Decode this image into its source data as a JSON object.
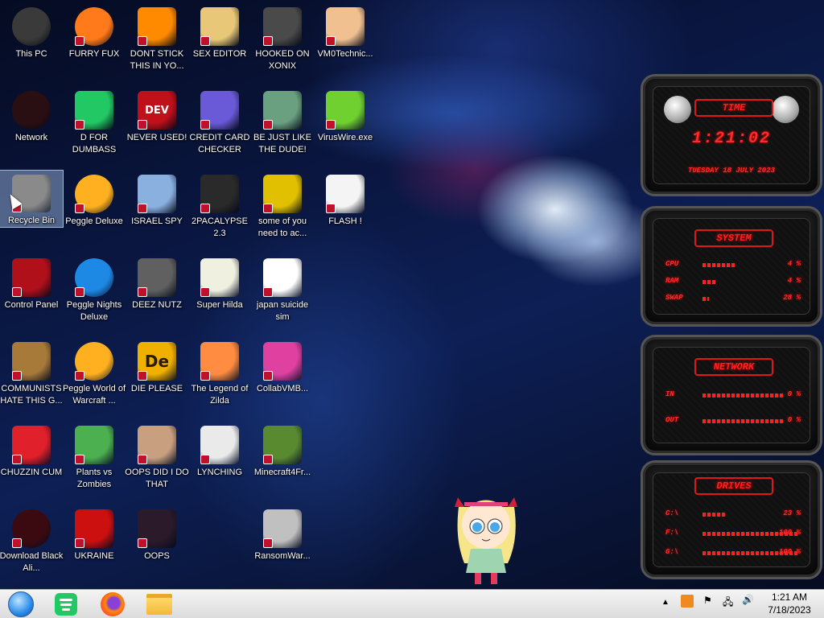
{
  "desktop": {
    "col1": [
      {
        "label": "This PC"
      },
      {
        "label": "Network"
      },
      {
        "label": "Recycle Bin"
      },
      {
        "label": "Control Panel"
      },
      {
        "label": "COMMUNISTS HATE THIS G..."
      },
      {
        "label": "CHUZZIN CUM"
      },
      {
        "label": "Download Black Ali..."
      }
    ],
    "col2": [
      {
        "label": "FURRY FUX"
      },
      {
        "label": "D FOR DUMBASS"
      },
      {
        "label": "Peggle Deluxe"
      },
      {
        "label": "Peggle Nights Deluxe"
      },
      {
        "label": "Peggle World of Warcraft ..."
      },
      {
        "label": "Plants vs Zombies"
      },
      {
        "label": "UKRAINE"
      }
    ],
    "col3": [
      {
        "label": "DONT STICK THIS IN YO..."
      },
      {
        "label": "NEVER USED!"
      },
      {
        "label": "ISRAEL SPY"
      },
      {
        "label": "DEEZ NUTZ"
      },
      {
        "label": "DIE PLEASE"
      },
      {
        "label": "OOPS DID I DO THAT"
      },
      {
        "label": "OOPS"
      }
    ],
    "col4": [
      {
        "label": "SEX EDITOR"
      },
      {
        "label": "CREDIT CARD CHECKER"
      },
      {
        "label": "2PACALYPSE 2.3"
      },
      {
        "label": "Super Hilda"
      },
      {
        "label": "The Legend of Zilda"
      },
      {
        "label": "LYNCHING"
      }
    ],
    "col5": [
      {
        "label": "HOOKED ON XONIX"
      },
      {
        "label": "BE JUST LIKE THE DUDE!"
      },
      {
        "label": "some of you need to ac..."
      },
      {
        "label": "japan suicide sim"
      },
      {
        "label": "CollabVMB..."
      },
      {
        "label": "Minecraft4Fr..."
      },
      {
        "label": "RansomWar..."
      }
    ],
    "col6": [
      {
        "label": "VM0Technic..."
      },
      {
        "label": "VirusWire.exe"
      },
      {
        "label": "FLASH !"
      }
    ],
    "dev_badge": "DEV",
    "dev_plus": "++",
    "de_badge": "De"
  },
  "widget": {
    "time": {
      "title": "TIME",
      "clock": "1:21:02",
      "date": "TUESDAY 18 JULY 2023"
    },
    "system": {
      "title": "SYSTEM",
      "rows": [
        {
          "name": "CPU",
          "value": "4 %"
        },
        {
          "name": "RAM",
          "value": "4 %"
        },
        {
          "name": "SWAP",
          "value": "28 %"
        }
      ]
    },
    "network": {
      "title": "NETWORK",
      "rows": [
        {
          "name": "IN",
          "value": "0 %"
        },
        {
          "name": "OUT",
          "value": "0 %"
        }
      ]
    },
    "drives": {
      "title": "DRIVES",
      "rows": [
        {
          "name": "C:\\",
          "value": "23 %"
        },
        {
          "name": "F:\\",
          "value": "100 %"
        },
        {
          "name": "G:\\",
          "value": "100 %"
        }
      ]
    }
  },
  "taskbar": {
    "time": "1:21 AM",
    "date": "7/18/2023"
  }
}
